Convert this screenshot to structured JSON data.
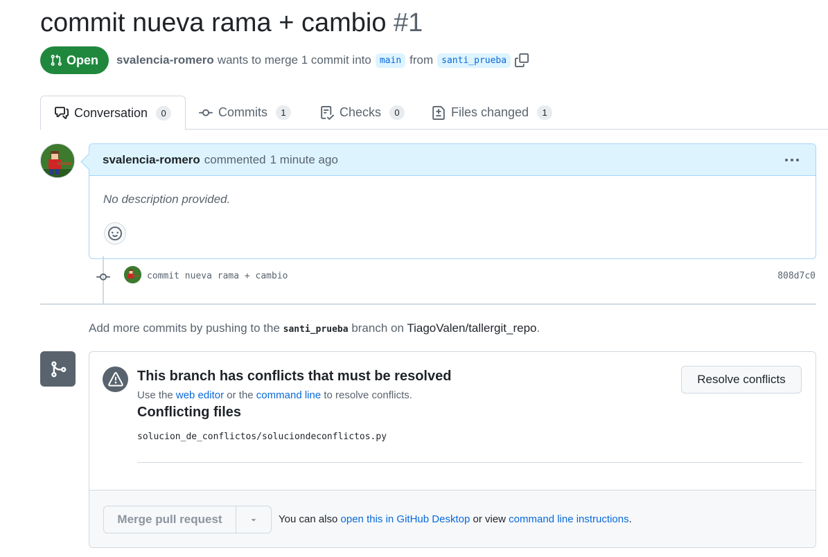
{
  "header": {
    "title": "commit nueva rama + cambio",
    "number": "#1",
    "state": "Open",
    "author": "svalencia-romero",
    "merge_text": "wants to merge 1 commit into",
    "base_branch": "main",
    "from_text": "from",
    "head_branch": "santi_prueba"
  },
  "tabs": [
    {
      "label": "Conversation",
      "count": "0",
      "icon": "comment-discussion-icon"
    },
    {
      "label": "Commits",
      "count": "1",
      "icon": "git-commit-icon"
    },
    {
      "label": "Checks",
      "count": "0",
      "icon": "checklist-icon"
    },
    {
      "label": "Files changed",
      "count": "1",
      "icon": "file-diff-icon"
    }
  ],
  "comment": {
    "author": "svalencia-romero",
    "action": "commented",
    "time": "1 minute ago",
    "body": "No description provided."
  },
  "commit": {
    "message": "commit nueva rama + cambio",
    "sha": "808d7c0"
  },
  "push_hint": {
    "prefix": "Add more commits by pushing to the",
    "branch": "santi_prueba",
    "middle": "branch on",
    "repo": "TiagoValen/tallergit_repo",
    "suffix": "."
  },
  "merge": {
    "conflict_title": "This branch has conflicts that must be resolved",
    "sub_prefix": "Use the",
    "web_editor": "web editor",
    "sub_middle": "or the",
    "command_line": "command line",
    "sub_suffix": "to resolve conflicts.",
    "files_title": "Conflicting files",
    "file_path": "solucion_de_conflictos/soluciondeconflictos.py",
    "resolve_button": "Resolve conflicts",
    "merge_button": "Merge pull request",
    "footer_prefix": "You can also",
    "footer_desktop_link": "open this in GitHub Desktop",
    "footer_middle": "or view",
    "footer_cli_link": "command line instructions",
    "footer_suffix": "."
  },
  "colors": {
    "open_green": "#1f883d",
    "link_blue": "#0969da",
    "comment_header_bg": "#ddf4ff"
  }
}
